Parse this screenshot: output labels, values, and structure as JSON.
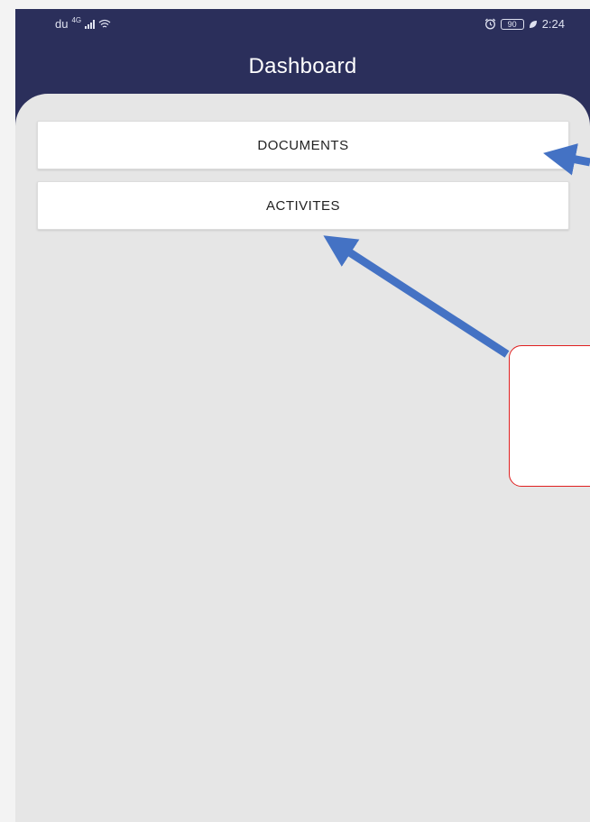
{
  "status_bar": {
    "carrier": "du",
    "network": "4G",
    "battery": "90",
    "time": "2:24"
  },
  "header": {
    "title": "Dashboard"
  },
  "menu": {
    "documents_label": "DOCUMENTS",
    "activites_label": "ACTIVITES"
  },
  "colors": {
    "header_bg": "#2b2f5b",
    "content_bg": "#e6e6e6",
    "arrow": "#4472c4",
    "callout_border": "#e02020"
  },
  "icons": [
    "signal-icon",
    "wifi-icon",
    "alarm-icon",
    "battery-icon",
    "leaf-icon"
  ]
}
